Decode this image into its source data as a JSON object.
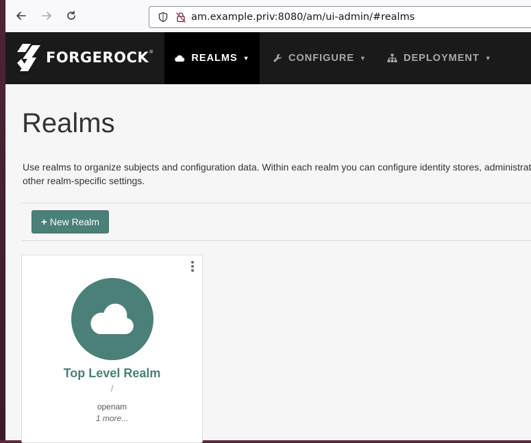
{
  "browser": {
    "url": "am.example.priv:8080/am/ui-admin/#realms",
    "back_icon": "arrow-left-icon",
    "forward_icon": "arrow-right-icon",
    "reload_icon": "reload-icon"
  },
  "header": {
    "logo_text": "FORGEROCK",
    "nav": [
      {
        "label": "REALMS",
        "icon": "cloud-icon",
        "active": true
      },
      {
        "label": "CONFIGURE",
        "icon": "wrench-icon",
        "active": false
      },
      {
        "label": "DEPLOYMENT",
        "icon": "sitemap-icon",
        "active": false
      }
    ]
  },
  "main": {
    "title": "Realms",
    "description": "Use realms to organize subjects and configuration data. Within each realm you can configure identity stores, administrati",
    "description_line2": "other realm-specific settings.",
    "new_realm_label": "New Realm",
    "realms": [
      {
        "name": "Top Level Realm",
        "path": "/",
        "alias": "openam",
        "more": "1 more..."
      }
    ]
  },
  "colors": {
    "accent": "#4a8078",
    "header_bg": "#1a1a1a",
    "active_nav_bg": "#000000",
    "content_bg": "#f6f6f6"
  }
}
